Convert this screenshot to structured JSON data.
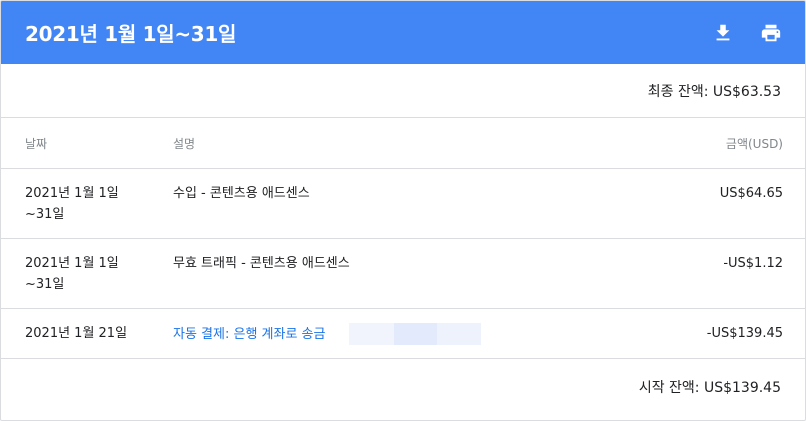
{
  "header": {
    "title": "2021년 1월 1일~31일",
    "download_icon": "download-icon",
    "print_icon": "print-icon",
    "bg_color": "#4285f4"
  },
  "final_balance": "최종 잔액: US$63.53",
  "table": {
    "columns": [
      "날짜",
      "설명",
      "금액(USD)"
    ],
    "rows": [
      {
        "date": "2021년 1월 1일\n~31일",
        "description": "수입 - 콘텐츠용 애드센스",
        "amount": "US$64.65",
        "link": false
      },
      {
        "date": "2021년 1월 1일\n~31일",
        "description": "무효 트래픽 - 콘텐츠용 애드센스",
        "amount": "-US$1.12",
        "link": false
      },
      {
        "date": "2021년 1월 21일",
        "description": "자동 결제: 은행 계좌로 송금",
        "amount": "-US$139.45",
        "link": true
      }
    ]
  },
  "starting_balance": "시작 잔액: US$139.45",
  "link_color": "#1a73e8"
}
